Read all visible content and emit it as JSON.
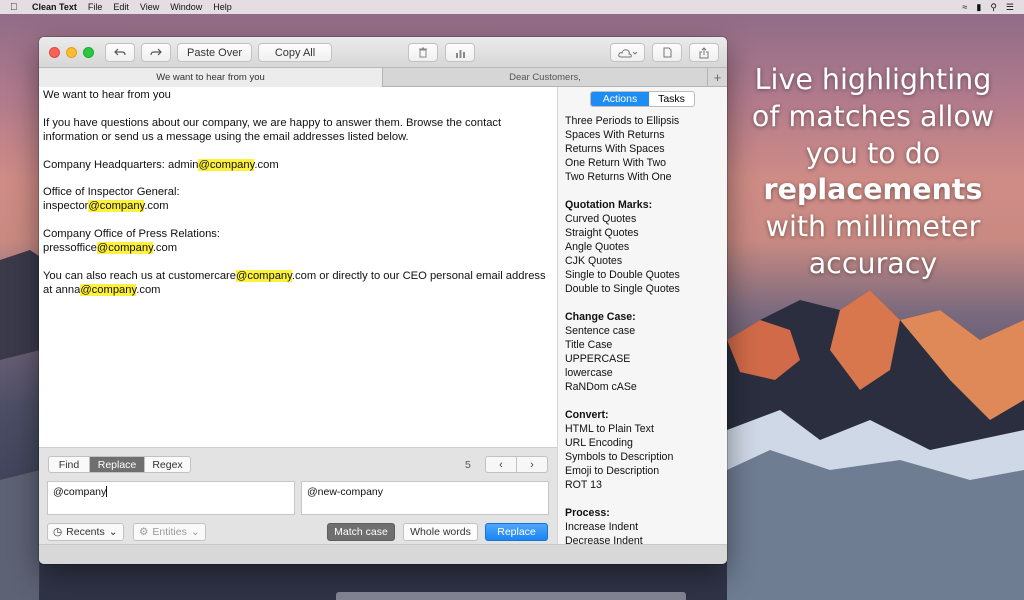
{
  "menubar": {
    "app_name": "Clean Text",
    "items": [
      "File",
      "Edit",
      "View",
      "Window",
      "Help"
    ]
  },
  "toolbar": {
    "paste_over_label": "Paste Over",
    "copy_all_label": "Copy All"
  },
  "tabs": [
    {
      "label": "We want to hear from you",
      "active": true
    },
    {
      "label": "Dear Customers,",
      "active": false
    }
  ],
  "editor": {
    "highlight_color": "#fdf13c",
    "paragraphs": [
      [
        "We want to hear from you"
      ],
      [
        "If you have questions about our company, we are happy to answer them. Browse the contact information or send us a message using the email addresses listed below."
      ],
      [
        "Company Headquarters: admin",
        "@company",
        ".com"
      ],
      [
        "Office of Inspector General:\ninspector",
        "@company",
        ".com"
      ],
      [
        "Company Office of Press Relations:\npressoffice",
        "@company",
        ".com"
      ],
      [
        "You can also reach us at customercare",
        "@company",
        ".com or directly to our CEO personal email address at anna",
        "@company",
        ".com"
      ]
    ]
  },
  "sidebar": {
    "segment_actions": "Actions",
    "segment_tasks": "Tasks",
    "groups": [
      {
        "header": "",
        "items": [
          "Three Periods to Ellipsis",
          "Spaces With Returns",
          "Returns With Spaces",
          "One Return With Two",
          "Two Returns With One"
        ]
      },
      {
        "header": "Quotation Marks:",
        "items": [
          "Curved Quotes",
          "Straight Quotes",
          "Angle Quotes",
          "CJK Quotes",
          "Single to Double Quotes",
          "Double to Single Quotes"
        ]
      },
      {
        "header": "Change Case:",
        "items": [
          "Sentence case",
          "Title Case",
          "UPPERCASE",
          "lowercase",
          "RaNDom cASe"
        ]
      },
      {
        "header": "Convert:",
        "items": [
          "HTML to Plain Text",
          "URL Encoding",
          "Symbols to Description",
          "Emoji to Description",
          "ROT 13"
        ]
      },
      {
        "header": "Process:",
        "items": [
          "Increase Indent",
          "Decrease Indent"
        ]
      }
    ]
  },
  "findbar": {
    "find_label": "Find",
    "replace_label": "Replace",
    "regex_label": "Regex",
    "match_count": "5",
    "find_value": "@company",
    "replace_value": "@new-company",
    "recents_label": "Recents",
    "entities_label": "Entities",
    "match_case_label": "Match case",
    "whole_words_label": "Whole words",
    "replace_button_label": "Replace"
  },
  "promo": {
    "line1": "Live highlighting",
    "line2": "of matches allow",
    "line3": "you to do",
    "line4_bold": "replacements",
    "line5": "with millimeter",
    "line6": "accuracy"
  },
  "colors": {
    "accent": "#1d8cf3",
    "highlight": "#fdf13c"
  }
}
